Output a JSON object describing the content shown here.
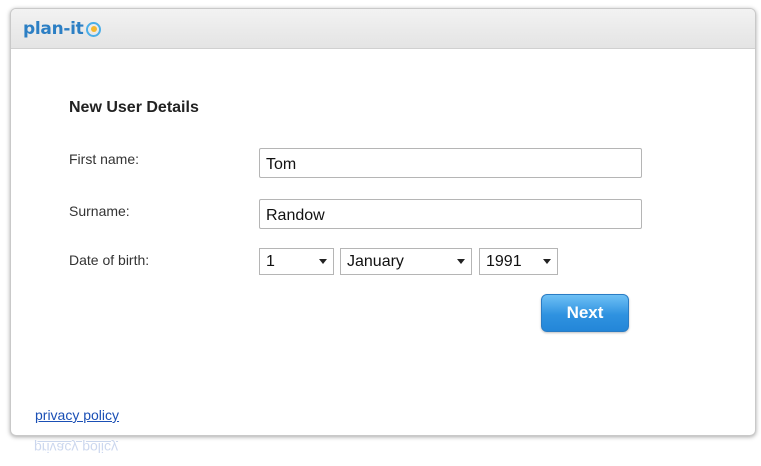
{
  "brand": {
    "logo_text": "plan-it"
  },
  "form": {
    "title": "New User Details",
    "first_name": {
      "label": "First name:",
      "value": "Tom"
    },
    "surname": {
      "label": "Surname:",
      "value": "Randow"
    },
    "date_of_birth": {
      "label": "Date of birth:",
      "day": "1",
      "month": "January",
      "year": "1991"
    },
    "next_label": "Next"
  },
  "footer": {
    "privacy_link": "privacy policy"
  },
  "colors": {
    "brand_blue": "#2c7fc4",
    "button_blue": "#2f92e0",
    "link_blue": "#1a4fb5"
  }
}
